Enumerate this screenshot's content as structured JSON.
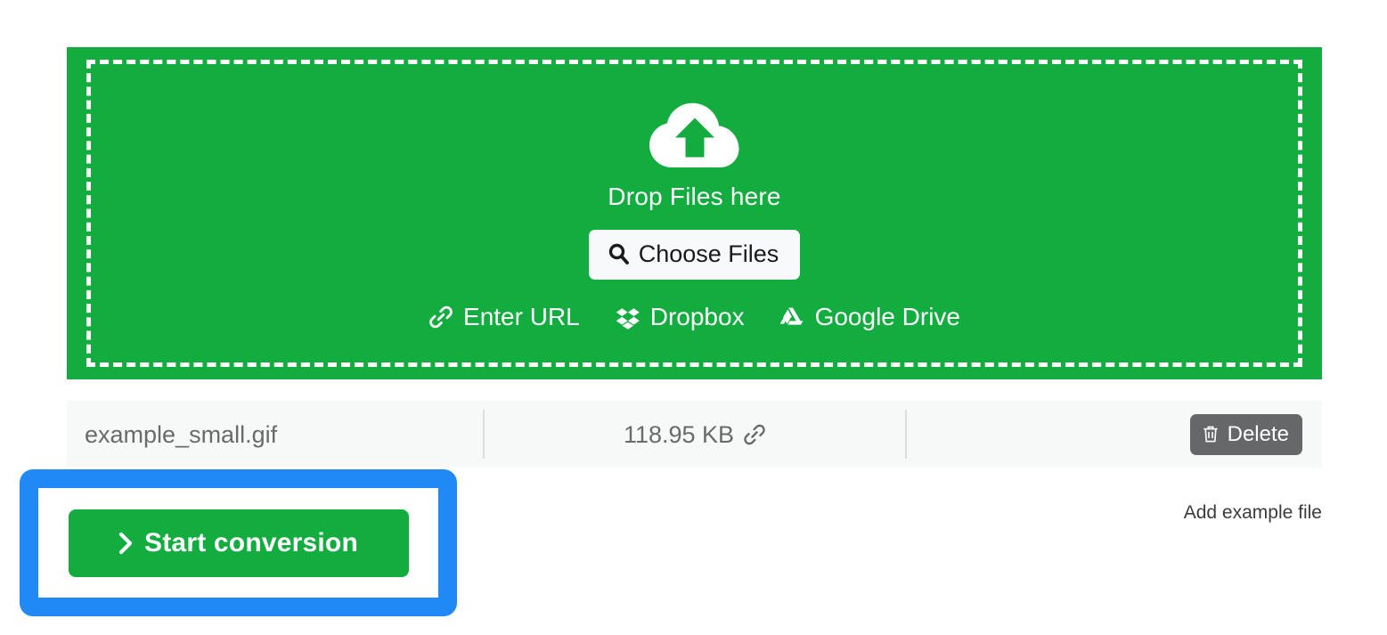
{
  "dropzone": {
    "icon": "cloud-upload-icon",
    "drop_label": "Drop Files here",
    "choose_files_label": "Choose Files",
    "choose_files_icon": "search-icon",
    "sources": [
      {
        "label": "Enter URL",
        "icon": "link-icon"
      },
      {
        "label": "Dropbox",
        "icon": "dropbox-icon"
      },
      {
        "label": "Google Drive",
        "icon": "google-drive-icon"
      }
    ]
  },
  "file_row": {
    "name": "example_small.gif",
    "size": "118.95 KB",
    "size_icon": "link-icon",
    "delete_label": "Delete",
    "delete_icon": "trash-icon"
  },
  "add_example_file_label": "Add example file",
  "start_conversion": {
    "label": "Start conversion",
    "icon": "chevron-right-icon"
  },
  "colors": {
    "green": "#12ac3f",
    "highlight_blue": "#2089f5",
    "row_background": "#f7f8f8",
    "delete_gray": "#666769",
    "text_gray": "#6a6a6a"
  }
}
